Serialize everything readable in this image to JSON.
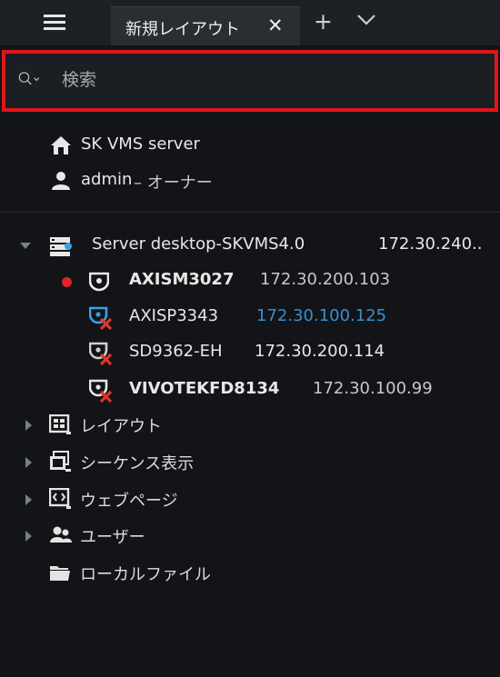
{
  "tabbar": {
    "tab_title": "新規レイアウト",
    "close_glyph": "✕",
    "add_glyph": "+"
  },
  "search": {
    "placeholder": "検索",
    "value": ""
  },
  "system": {
    "name": "SK VMS server",
    "user": "admin",
    "user_role": " – オーナー"
  },
  "server": {
    "name": "Server desktop-SKVMS4.0",
    "ip": "172.30.240..",
    "cameras": [
      {
        "name": "AXISM3027",
        "ip": "172.30.200.103",
        "status": "recording"
      },
      {
        "name": "AXISP3343",
        "ip": "172.30.100.125",
        "status": "selected-offline"
      },
      {
        "name": "SD9362-EH",
        "ip": "172.30.200.114",
        "status": "offline"
      },
      {
        "name": "VIVOTEKFD8134",
        "ip": "172.30.100.99",
        "status": "offline"
      }
    ]
  },
  "nodes": {
    "layouts": "レイアウト",
    "showreels": "シーケンス表示",
    "webpages": "ウェブページ",
    "users": "ユーザー",
    "local_files": "ローカルファイル"
  },
  "colors": {
    "search_highlight": "#e0171a",
    "selected": "#3aa0e8",
    "recording": "#e0232b",
    "offline_x": "#e0352b",
    "background": "#121417"
  }
}
